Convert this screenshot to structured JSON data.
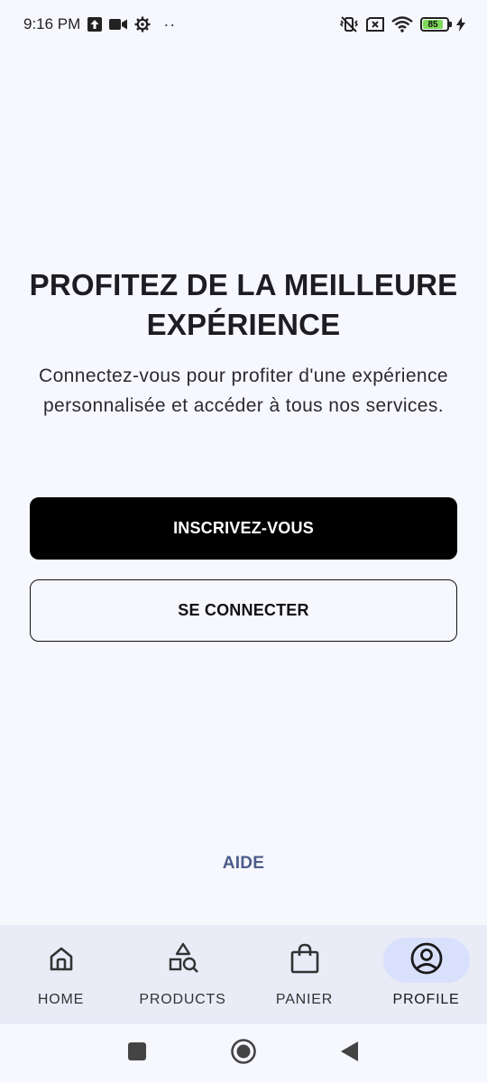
{
  "status_bar": {
    "time": "9:16 PM",
    "battery_level": "85",
    "left_icons": [
      "upload-icon",
      "video-camera-icon",
      "gear-icon",
      "more-dots-icon"
    ],
    "right_icons": [
      "vibrate-off-icon",
      "sim-x-icon",
      "wifi-icon",
      "battery-icon",
      "charging-bolt-icon"
    ],
    "battery_color": "#7ed957"
  },
  "main": {
    "title": "PROFITEZ DE LA MEILLEURE EXPÉRIENCE",
    "subtitle": "Connectez-vous pour profiter d'une expérience personnalisée et accéder à tous nos services.",
    "signup_label": "INSCRIVEZ-VOUS",
    "login_label": "SE CONNECTER",
    "help_label": "AIDE"
  },
  "bottom_nav": {
    "items": [
      {
        "label": "HOME",
        "icon": "home-icon",
        "active": false
      },
      {
        "label": "PRODUCTS",
        "icon": "shapes-search-icon",
        "active": false
      },
      {
        "label": "PANIER",
        "icon": "shopping-bag-icon",
        "active": false
      },
      {
        "label": "PROFILE",
        "icon": "account-circle-icon",
        "active": true
      }
    ]
  },
  "system_nav": {
    "icons": [
      "recent-apps-icon",
      "home-circle-icon",
      "back-triangle-icon"
    ]
  },
  "colors": {
    "background": "#f7f8fe",
    "primary_button": "#000000",
    "help_link": "#4b5c8a",
    "nav_background": "#e9ebf7",
    "nav_active_pill": "#d9e0fb"
  }
}
